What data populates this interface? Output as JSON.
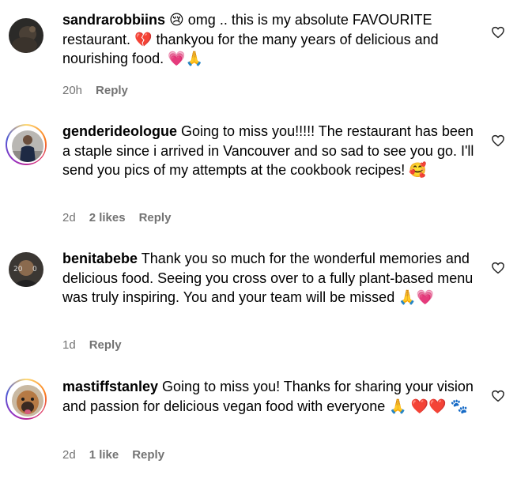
{
  "comments": [
    {
      "username": "sandrarobbiins",
      "text": " 😢 omg .. this is my absolute FAVOURITE restaurant. 💔 thankyou for the many years of delicious and nourishing food. 💗🙏",
      "time": "20h",
      "likes": "",
      "reply": "Reply"
    },
    {
      "username": "genderideologue",
      "text": " Going to miss you!!!!! The restaurant has been a staple since i arrived in Vancouver and so sad to see you go. I'll send you pics of my attempts at the cookbook recipes! 🥰",
      "time": "2d",
      "likes": "2 likes",
      "reply": "Reply"
    },
    {
      "username": "benitabebe",
      "text": " Thank you so much for the wonderful memories and delicious food. Seeing you cross over to a fully plant-based menu was truly inspiring. You and your team will be missed 🙏💗",
      "time": "1d",
      "likes": "",
      "reply": "Reply"
    },
    {
      "username": "mastiffstanley",
      "text": " Going to miss you! Thanks for sharing your vision and passion for delicious vegan food with everyone 🙏 ❤️❤️ 🐾",
      "time": "2d",
      "likes": "1 like",
      "reply": "Reply"
    }
  ],
  "icons": {
    "like": "heart-outline-icon"
  },
  "colors": {
    "meta": "#737373",
    "text": "#000000"
  }
}
